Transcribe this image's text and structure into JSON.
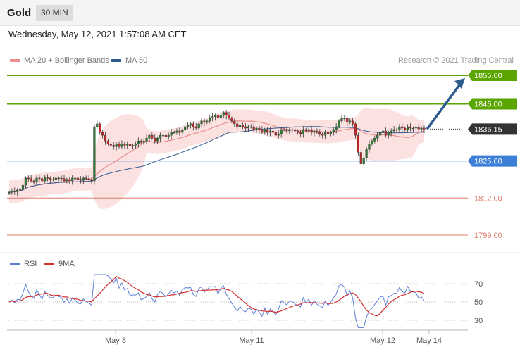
{
  "header": {
    "instrument": "Gold",
    "timeframe": "30 MIN"
  },
  "datetime": "Wednesday, May 12, 2021 1:57:08 AM CET",
  "legend": {
    "ma20_label": "MA 20 + Bollinger Bands",
    "ma50_label": "MA 50",
    "credit": "Research © 2021 Trading Central"
  },
  "rsi_legend": {
    "rsi_label": "RSI",
    "ma_label": "9MA"
  },
  "colors": {
    "resistance": "#5aa500",
    "support": "#3b7fd6",
    "target_low": "#e07a6a",
    "current": "#333333",
    "ma20": "#ec8e8e",
    "ma50": "#2f5b91",
    "bollinger": "#fbdcdc",
    "candle_up": "#2e7d32",
    "candle_down": "#c62828",
    "rsi": "#5b7fd6",
    "rsi_ma": "#d32f2f",
    "arrow": "#2f5b91"
  },
  "chart_data": [
    {
      "type": "candlestick",
      "title": "Gold",
      "ylim": [
        1792,
        1860
      ],
      "x_ticks": [
        "May 8",
        "May 11",
        "May 12",
        "May 14"
      ],
      "levels": [
        {
          "value": 1855.0,
          "label": "1855.00",
          "kind": "resistance"
        },
        {
          "value": 1845.0,
          "label": "1845.00",
          "kind": "resistance"
        },
        {
          "value": 1836.15,
          "label": "1836.15",
          "kind": "current"
        },
        {
          "value": 1825.0,
          "label": "1825.00",
          "kind": "support"
        },
        {
          "value": 1812.0,
          "label": "1812.00",
          "kind": "target_low"
        },
        {
          "value": 1799.0,
          "label": "1799.00",
          "kind": "target_low"
        }
      ],
      "series": [
        {
          "name": "MA 20 + Bollinger Bands"
        },
        {
          "name": "MA 50"
        }
      ],
      "close_values": [
        1814,
        1814.5,
        1814.2,
        1814.8,
        1815,
        1816.5,
        1819,
        1818.8,
        1818,
        1817.5,
        1819,
        1818.8,
        1818,
        1819.2,
        1819,
        1818.5,
        1818.5,
        1819,
        1819,
        1818.8,
        1818,
        1818.5,
        1818,
        1819,
        1819,
        1818.5,
        1818.2,
        1819,
        1818.8,
        1818.5,
        1818,
        1837,
        1838,
        1835,
        1834,
        1832,
        1831,
        1830.5,
        1830,
        1831,
        1830,
        1831,
        1830.5,
        1831,
        1830.2,
        1830.5,
        1831,
        1832,
        1831.5,
        1832,
        1833,
        1834,
        1833,
        1832,
        1833,
        1834,
        1834,
        1833.5,
        1834,
        1835,
        1835,
        1835.5,
        1835,
        1836,
        1837,
        1837.5,
        1838,
        1837,
        1836.5,
        1838,
        1839,
        1838.5,
        1839,
        1840,
        1840.5,
        1841,
        1840,
        1841,
        1842,
        1841,
        1840,
        1839,
        1838,
        1837,
        1837.5,
        1837,
        1836.5,
        1837,
        1837,
        1836,
        1836.5,
        1836,
        1835,
        1836,
        1835,
        1835.5,
        1835,
        1834,
        1834.5,
        1836,
        1836,
        1835.5,
        1836,
        1836,
        1835.5,
        1835,
        1834.5,
        1836,
        1835.5,
        1836,
        1835,
        1835.5,
        1835,
        1834.5,
        1834,
        1835,
        1834.5,
        1835,
        1836,
        1837,
        1839,
        1840,
        1840,
        1838.5,
        1839,
        1838,
        1834,
        1828,
        1824,
        1826,
        1829,
        1831,
        1832,
        1833,
        1834,
        1835,
        1835.5,
        1834,
        1835,
        1835.5,
        1836,
        1836,
        1837,
        1836.5,
        1836,
        1837,
        1836.5,
        1836.5,
        1836.8,
        1836.2,
        1836.5,
        1836.15
      ],
      "close_values_ylabel": "",
      "arrow": {
        "from": 1836.15,
        "to": 1855.0
      }
    },
    {
      "type": "line",
      "title": "RSI",
      "ylim": [
        20,
        85
      ],
      "y_ticks": [
        70,
        50,
        30
      ],
      "series": [
        {
          "name": "RSI"
        },
        {
          "name": "9MA"
        }
      ]
    }
  ]
}
